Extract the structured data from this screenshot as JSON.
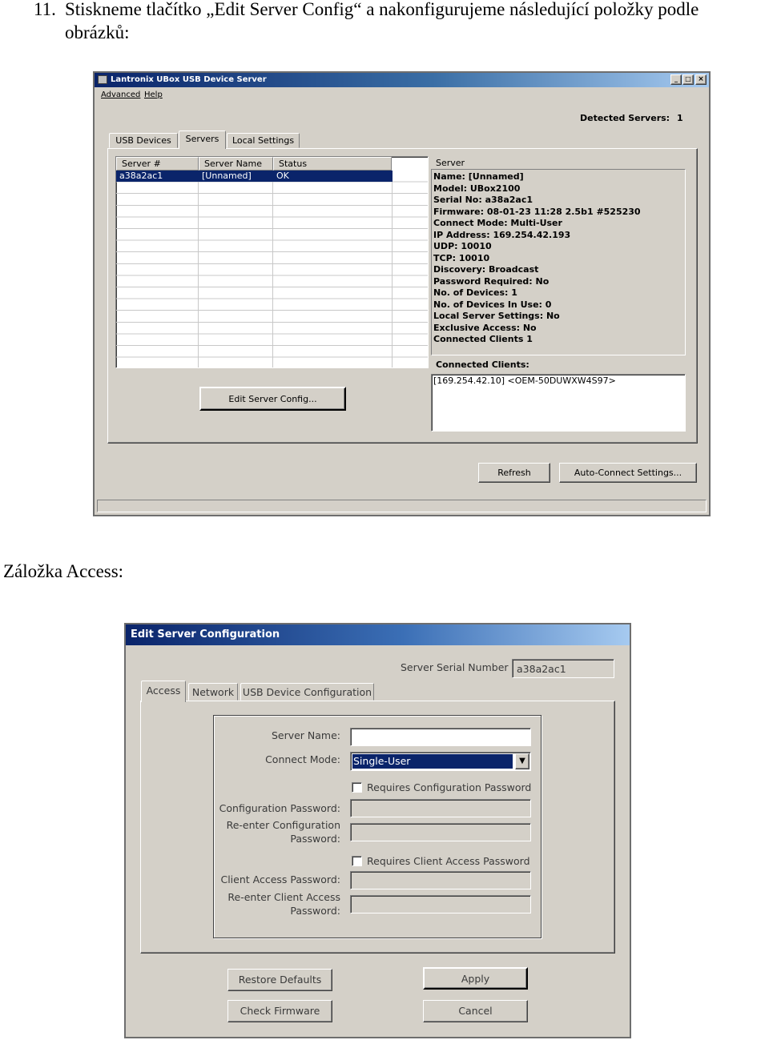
{
  "doc": {
    "step_number": "11.",
    "step_line1": "Stiskneme tlačítko „Edit Server Config“ a nakonfigurujeme následující položky podle",
    "step_line2": "obrázků:",
    "section_access": "Záložka Access:"
  },
  "window1": {
    "title": "Lantronix UBox USB Device Server",
    "menu": [
      "Advanced",
      "Help"
    ],
    "detected_servers_label": "Detected Servers:",
    "detected_servers_value": "1",
    "tabs": [
      "USB Devices",
      "Servers",
      "Local Settings"
    ],
    "active_tab": "Servers",
    "table": {
      "columns": [
        "Server #",
        "Server Name",
        "Status"
      ],
      "rows": [
        {
          "server_no": "a38a2ac1",
          "server_name": "[Unnamed]",
          "status": "OK"
        }
      ]
    },
    "server_group_label": "Server",
    "server_details": [
      "Name: [Unnamed]",
      "Model: UBox2100",
      "Serial No: a38a2ac1",
      "Firmware: 08-01-23 11:28 2.5b1 #525230",
      "Connect Mode: Multi-User",
      "IP Address: 169.254.42.193",
      "UDP: 10010",
      "TCP: 10010",
      "Discovery: Broadcast",
      "Password Required: No",
      "No. of Devices: 1",
      "No. of Devices In Use: 0",
      "Local Server Settings: No",
      "Exclusive Access: No",
      "Connected Clients 1"
    ],
    "connected_clients_label": "Connected Clients:",
    "connected_clients": [
      "[169.254.42.10]  <OEM-50DUWXW4S97>"
    ],
    "edit_button": "Edit Server Config...",
    "refresh_button": "Refresh",
    "auto_connect_button": "Auto-Connect Settings..."
  },
  "window2": {
    "title": "Edit Server Configuration",
    "serial_label": "Server Serial Number",
    "serial_value": "a38a2ac1",
    "tabs": [
      "Access",
      "Network",
      "USB Device Configuration"
    ],
    "active_tab": "Access",
    "server_name_label": "Server Name:",
    "server_name_value": "",
    "connect_mode_label": "Connect Mode:",
    "connect_mode_value": "Single-User",
    "requires_config_password_label": "Requires Configuration Password",
    "requires_config_password_checked": false,
    "config_password_label": "Configuration Password:",
    "reenter_config_label_1": "Re-enter Configuration",
    "reenter_config_label_2": "Password:",
    "requires_client_password_label": "Requires Client Access Password",
    "requires_client_password_checked": false,
    "client_password_label": "Client Access Password:",
    "reenter_client_label_1": "Re-enter Client Access",
    "reenter_client_label_2": "Password:",
    "restore_defaults_button": "Restore Defaults",
    "check_firmware_button": "Check Firmware",
    "apply_button": "Apply",
    "cancel_button": "Cancel"
  }
}
